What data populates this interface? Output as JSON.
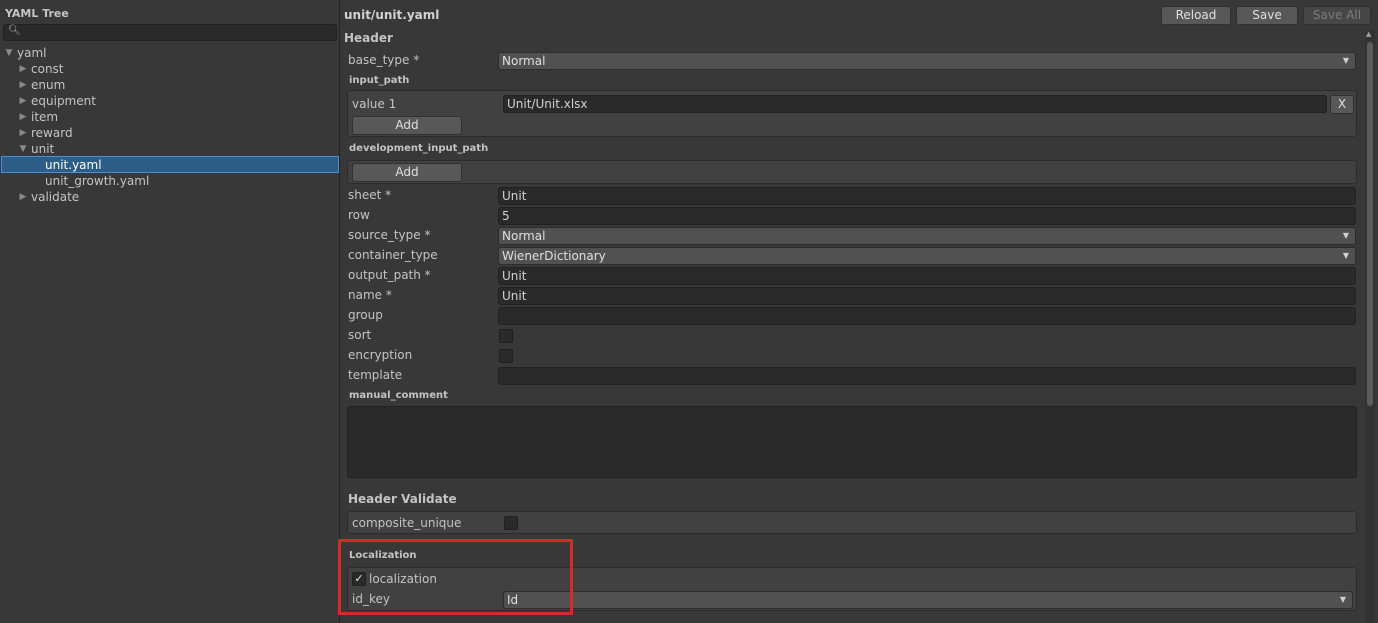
{
  "tree": {
    "title": "YAML Tree",
    "search_placeholder": "",
    "items": [
      {
        "label": "yaml",
        "expanded": true
      },
      {
        "label": "const",
        "expanded": false
      },
      {
        "label": "enum",
        "expanded": false
      },
      {
        "label": "equipment",
        "expanded": false
      },
      {
        "label": "item",
        "expanded": false
      },
      {
        "label": "reward",
        "expanded": false
      },
      {
        "label": "unit",
        "expanded": true
      },
      {
        "label": "unit.yaml",
        "selected": true
      },
      {
        "label": "unit_growth.yaml"
      },
      {
        "label": "validate",
        "expanded": false
      }
    ]
  },
  "toolbar": {
    "file_title": "unit/unit.yaml",
    "reload_label": "Reload",
    "save_label": "Save",
    "save_all_label": "Save All"
  },
  "header": {
    "title": "Header",
    "base_type": {
      "label": "base_type *",
      "value": "Normal"
    },
    "input_path": {
      "title": "input_path",
      "items": [
        {
          "label": "value 1",
          "value": "Unit/Unit.xlsx",
          "remove_label": "X"
        }
      ],
      "add_label": "Add"
    },
    "development_input_path": {
      "title": "development_input_path",
      "add_label": "Add"
    },
    "sheet": {
      "label": "sheet *",
      "value": "Unit"
    },
    "row": {
      "label": "row",
      "value": "5"
    },
    "source_type": {
      "label": "source_type *",
      "value": "Normal"
    },
    "container_type": {
      "label": "container_type",
      "value": "WienerDictionary"
    },
    "output_path": {
      "label": "output_path *",
      "value": "Unit"
    },
    "name": {
      "label": "name *",
      "value": "Unit"
    },
    "group": {
      "label": "group",
      "value": ""
    },
    "sort": {
      "label": "sort",
      "checked": false
    },
    "encryption": {
      "label": "encryption",
      "checked": false
    },
    "template": {
      "label": "template",
      "value": ""
    },
    "manual_comment": {
      "title": "manual_comment",
      "value": ""
    }
  },
  "header_validate": {
    "title": "Header Validate",
    "composite_unique": {
      "label": "composite_unique",
      "checked": false
    }
  },
  "localization": {
    "title": "Localization",
    "localization": {
      "label": "localization",
      "checked": true,
      "check_glyph": "✓"
    },
    "id_key": {
      "label": "id_key",
      "value": "Id"
    }
  },
  "colors": {
    "selection": "#2c5d87",
    "highlight_outline": "#d42a2a",
    "panel_bg": "#383838"
  }
}
